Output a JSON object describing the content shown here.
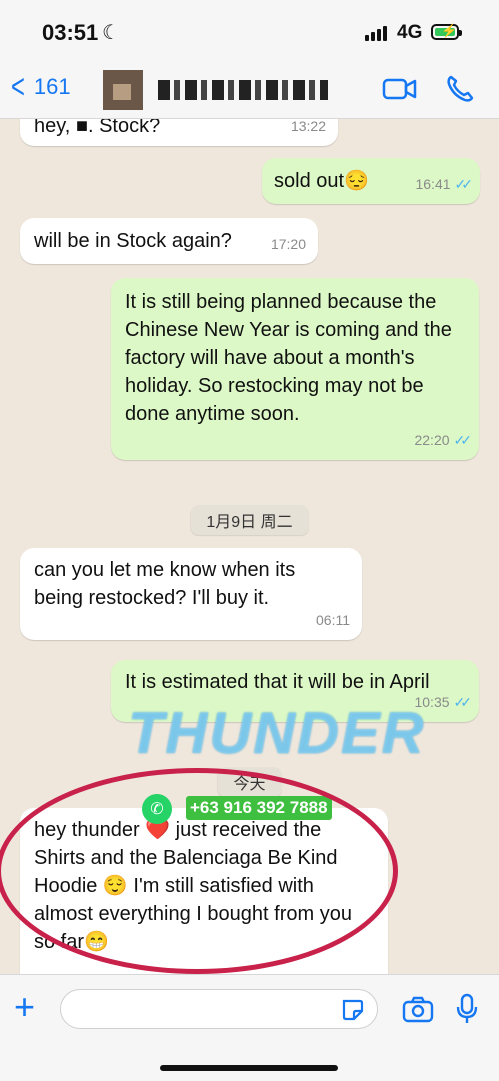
{
  "status": {
    "time": "03:51",
    "network": "4G"
  },
  "header": {
    "back_count": "161"
  },
  "messages": [
    {
      "dir": "in",
      "text": "hey, ■. Stock?",
      "time": "13:22"
    },
    {
      "dir": "out",
      "text": "sold out😔",
      "time": "16:41"
    },
    {
      "dir": "in",
      "text": "will be in Stock again?",
      "time": "17:20"
    },
    {
      "dir": "out",
      "text": "It is still being planned because the Chinese New Year is coming and the factory will have about a month's holiday. So restocking may not be done anytime soon.",
      "time": "22:20"
    },
    {
      "dir": "in",
      "text": "can you let me know when its being restocked? I'll buy it.",
      "time": "06:11"
    },
    {
      "dir": "out",
      "text": "It is estimated that it will be in April",
      "time": "10:35"
    },
    {
      "dir": "in",
      "text": "hey thunder ❤️ just received the Shirts and the Balenciaga Be Kind Hoodie 😌 I'm still satisfied with almost everything I bought from you so far😁",
      "time": ""
    }
  ],
  "dates": {
    "date1": "1月9日 周二",
    "today": "今天"
  },
  "watermark": {
    "brand": "THUNDER",
    "phone": "+63 916 392 7888"
  }
}
